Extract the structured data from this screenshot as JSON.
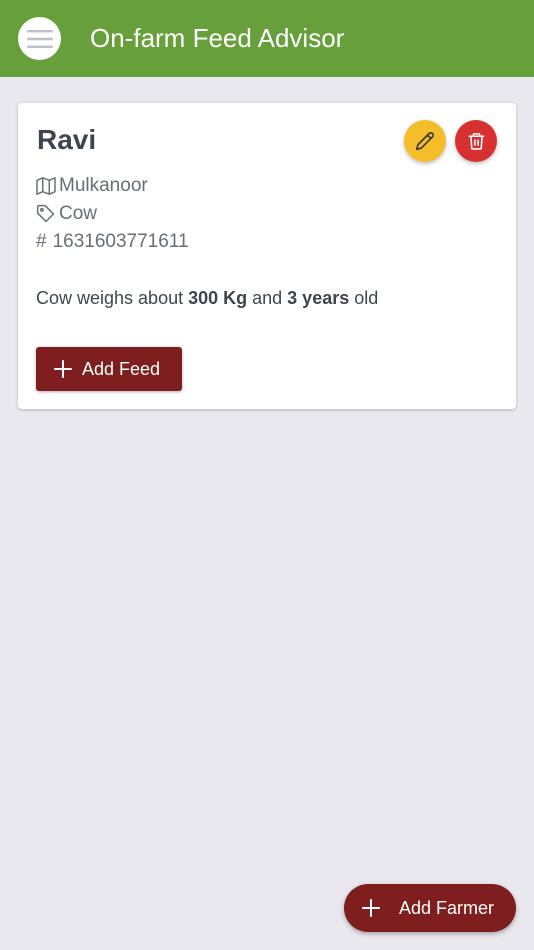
{
  "app_bar": {
    "menu_icon": "hamburger-menu-icon",
    "title": "On-farm Feed Advisor",
    "color": "#67a03a"
  },
  "farmer_card": {
    "name": "Ravi",
    "edit_icon": "pencil-icon",
    "delete_icon": "trash-icon",
    "location_icon": "map-icon",
    "location": "Mulkanoor",
    "animal_icon": "tag-icon",
    "animal": "Cow",
    "id_icon": "hash-icon",
    "id_symbol": "#",
    "id": "1631603771611",
    "description": {
      "prefix": "Cow weighs about ",
      "weight": "300 Kg",
      "middle": " and ",
      "age": "3 years",
      "suffix": " old"
    },
    "add_feed_label": "Add Feed"
  },
  "fab": {
    "label": "Add Farmer",
    "icon": "plus-icon"
  },
  "colors": {
    "primary_green": "#67a03a",
    "dark_red": "#7f1e1e",
    "edit_yellow": "#f6bd2a",
    "delete_red": "#d63030",
    "background": "#e8e8ee"
  }
}
